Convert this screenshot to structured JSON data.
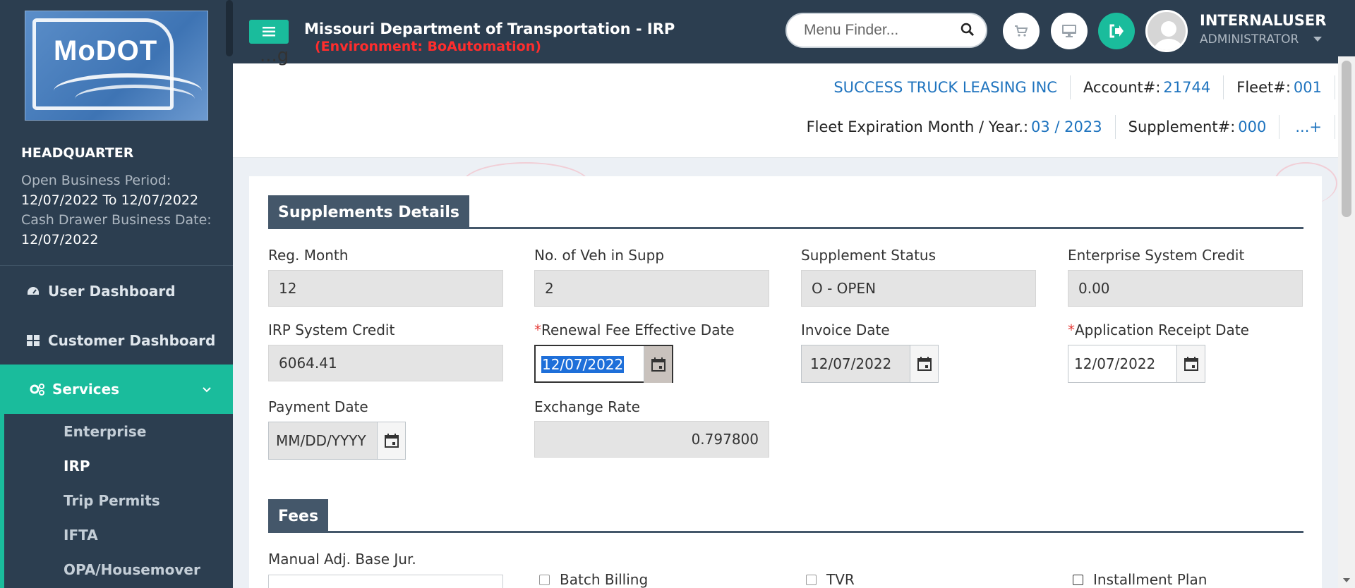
{
  "sidebar": {
    "logo_text": "MoDOT",
    "location": "HEADQUARTER",
    "open_period_label": "Open Business Period:",
    "open_period_value": "12/07/2022 To 12/07/2022",
    "cash_drawer_label": "Cash Drawer Business Date:",
    "cash_drawer_value": "12/07/2022",
    "nav": [
      {
        "label": "User Dashboard",
        "icon": "dashboard-icon"
      },
      {
        "label": "Customer Dashboard",
        "icon": "grid-icon"
      },
      {
        "label": "Services",
        "icon": "gears-icon"
      }
    ],
    "subnav": [
      "Enterprise",
      "IRP",
      "Trip Permits",
      "IFTA",
      "OPA/Housemover"
    ]
  },
  "header": {
    "title": "Missouri Department of Transportation - IRP",
    "environment": "(Environment: BoAutomation)",
    "menu_finder_placeholder": "Menu Finder...",
    "user_name": "INTERNALUSER",
    "user_role": "ADMINISTRATOR"
  },
  "info": {
    "partial_title": "...g",
    "company": "SUCCESS TRUCK LEASING INC",
    "account_label": "Account#:",
    "account_value": "21744",
    "fleet_label": "Fleet#:",
    "fleet_value": "001",
    "expiration_label": "Fleet Expiration Month / Year.:",
    "expiration_value": "03 / 2023",
    "supplement_label": "Supplement#:",
    "supplement_value": "000",
    "more": "...+"
  },
  "supplements": {
    "heading": "Supplements Details",
    "reg_month_label": "Reg. Month",
    "reg_month_value": "12",
    "veh_label": "No. of Veh in Supp",
    "veh_value": "2",
    "status_label": "Supplement Status",
    "status_value": "O - OPEN",
    "esc_label": "Enterprise System Credit",
    "esc_value": "0.00",
    "irp_credit_label": "IRP System Credit",
    "irp_credit_value": "6064.41",
    "renewal_label": "Renewal Fee Effective Date",
    "renewal_value": "12/07/2022",
    "invoice_label": "Invoice Date",
    "invoice_value": "12/07/2022",
    "receipt_label": "Application Receipt Date",
    "receipt_value": "12/07/2022",
    "payment_label": "Payment Date",
    "payment_placeholder": "MM/DD/YYYY",
    "exchange_label": "Exchange Rate",
    "exchange_value": "0.797800",
    "required_mark": "*"
  },
  "fees": {
    "heading": "Fees",
    "manual_adj_label": "Manual Adj. Base Jur.",
    "batch_billing": "Batch Billing",
    "tvr": "TVR",
    "installment_plan": "Installment Plan"
  }
}
